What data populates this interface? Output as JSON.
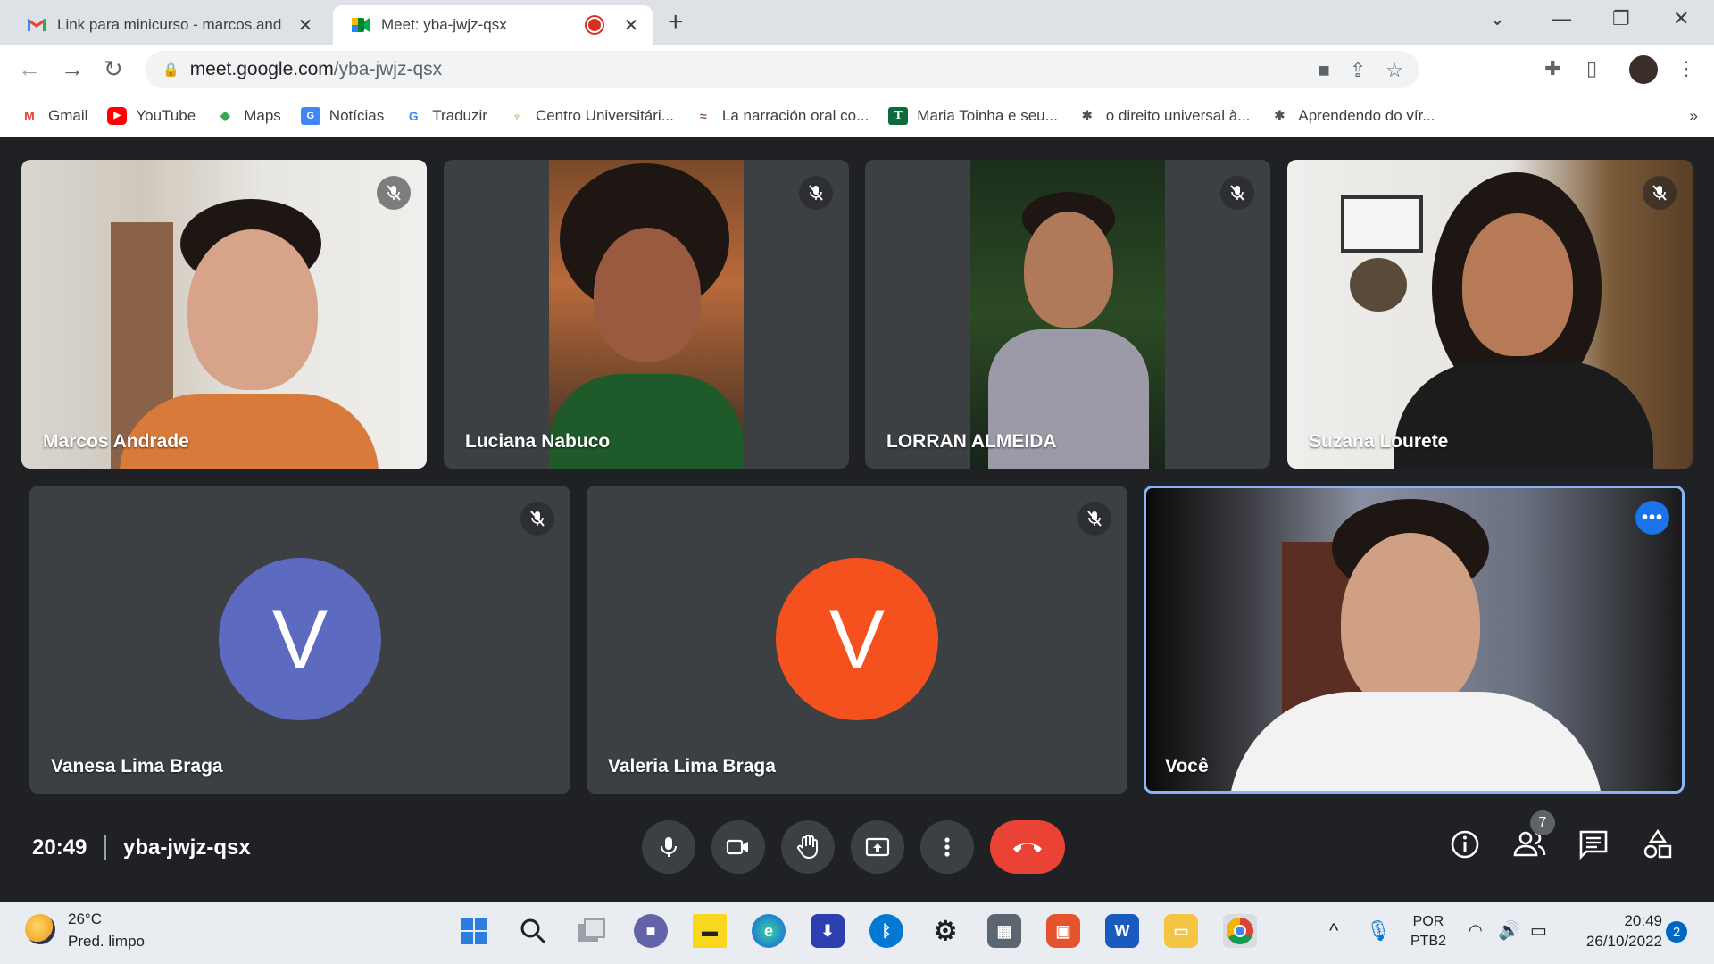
{
  "browser": {
    "tabs": [
      {
        "title": "Link para minicurso - marcos.and",
        "active": false
      },
      {
        "title": "Meet: yba-jwjz-qsx",
        "active": true
      }
    ],
    "url_domain": "meet.google.com",
    "url_path": "/yba-jwjz-qsx",
    "bookmarks": [
      "Gmail",
      "YouTube",
      "Maps",
      "Notícias",
      "Traduzir",
      "Centro Universitári...",
      "La narración oral co...",
      "Maria Toinha e seu...",
      "o direito universal à...",
      "Aprendendo do vír..."
    ],
    "more_bookmarks": "»"
  },
  "participants": [
    {
      "name": "Marcos Andrade",
      "muted": true
    },
    {
      "name": "Luciana Nabuco",
      "muted": true
    },
    {
      "name": "LORRAN ALMEIDA",
      "muted": true
    },
    {
      "name": "Suzana Lourete",
      "muted": true
    },
    {
      "name": "Vanesa Lima Braga",
      "muted": true,
      "initial": "V",
      "color": "#5c6bc0"
    },
    {
      "name": "Valeria Lima Braga",
      "muted": true,
      "initial": "V",
      "color": "#f4511e"
    },
    {
      "name": "Você",
      "muted": false,
      "self": true
    }
  ],
  "meeting": {
    "time": "20:49",
    "code": "yba-jwjz-qsx",
    "participant_count": "7"
  },
  "colors": {
    "accent": "#8ab4f8",
    "end_call": "#ea4335",
    "more_button": "#1a73e8"
  },
  "taskbar": {
    "weather_temp": "26°C",
    "weather_desc": "Pred. limpo",
    "lang_line1": "POR",
    "lang_line2": "PTB2",
    "clock_time": "20:49",
    "clock_date": "26/10/2022",
    "notification_count": "2"
  }
}
